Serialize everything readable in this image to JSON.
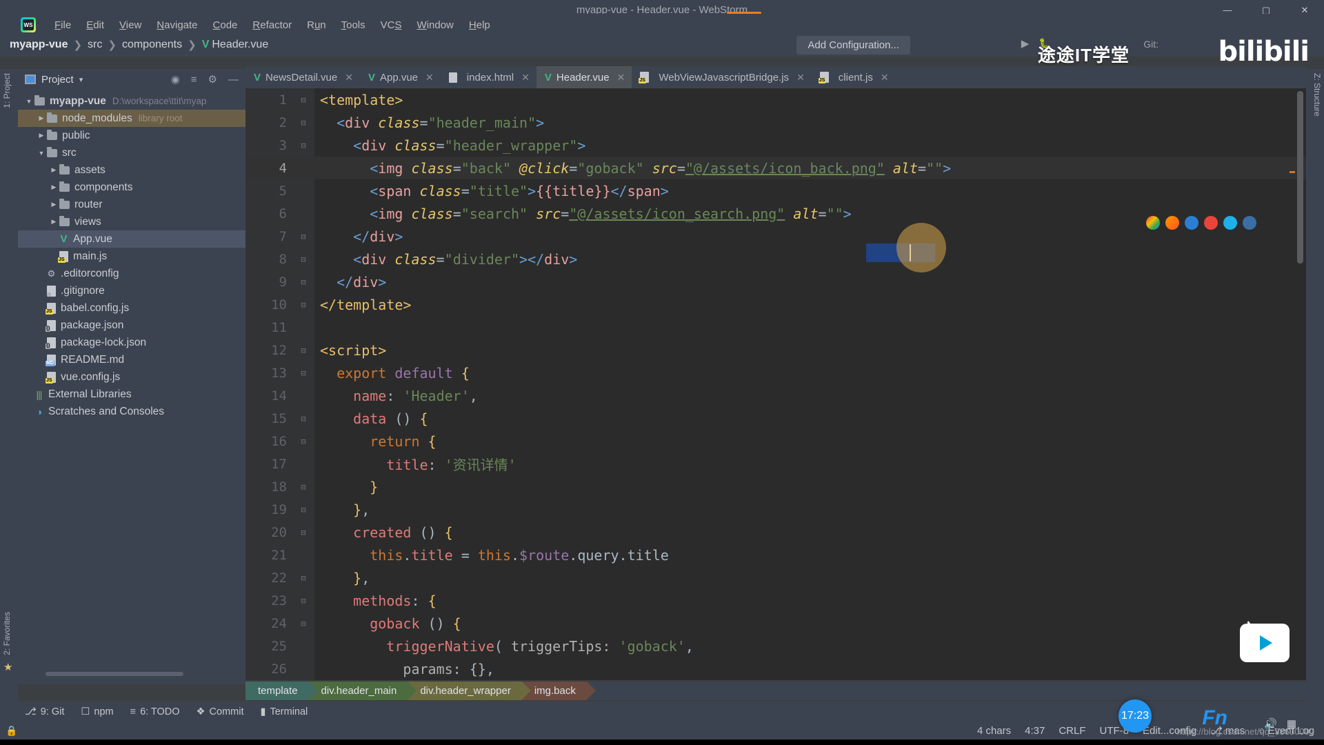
{
  "window": {
    "title": "myapp-vue - Header.vue - WebStorm",
    "minimize": "—",
    "maximize": "▢",
    "close": "✕"
  },
  "menu": {
    "logo": "webstorm-logo",
    "items": [
      {
        "label": "File",
        "mnemonic": "F"
      },
      {
        "label": "Edit",
        "mnemonic": "E"
      },
      {
        "label": "View",
        "mnemonic": "V"
      },
      {
        "label": "Navigate",
        "mnemonic": "N"
      },
      {
        "label": "Code",
        "mnemonic": "C"
      },
      {
        "label": "Refactor",
        "mnemonic": "R"
      },
      {
        "label": "Run",
        "mnemonic": "R"
      },
      {
        "label": "Tools",
        "mnemonic": "T"
      },
      {
        "label": "VCS",
        "mnemonic": "S"
      },
      {
        "label": "Window",
        "mnemonic": "W"
      },
      {
        "label": "Help",
        "mnemonic": "H"
      }
    ]
  },
  "navbar": {
    "breadcrumbs": [
      "myapp-vue",
      "src",
      "components",
      "Header.vue"
    ],
    "separator": "❯",
    "add_configuration": "Add Configuration...",
    "git_label": "Git:"
  },
  "watermark": {
    "tutu": "途途IT学堂",
    "bilibili": "bilibili",
    "csdn": "https://blog.csdn.net/qq_33600000"
  },
  "rails": {
    "left_top": "1: Project",
    "left_bottom": "2: Favorites",
    "right_top": "Z: Structure"
  },
  "project_panel": {
    "title": "Project",
    "caret": "▾",
    "tools": [
      "⊕",
      "⇅",
      "⚙",
      "—"
    ],
    "tree": [
      {
        "label": "myapp-vue",
        "suffix": "D:\\workspace\\ttit\\myap",
        "type": "folder",
        "indent": 0,
        "arrow": "▼",
        "bold": true
      },
      {
        "label": "node_modules",
        "suffix": "library root",
        "type": "folder",
        "indent": 1,
        "arrow": "▶",
        "highlight": true
      },
      {
        "label": "public",
        "type": "folder",
        "indent": 1,
        "arrow": "▶"
      },
      {
        "label": "src",
        "type": "folder",
        "indent": 1,
        "arrow": "▼"
      },
      {
        "label": "assets",
        "type": "folder",
        "indent": 2,
        "arrow": "▶"
      },
      {
        "label": "components",
        "type": "folder",
        "indent": 2,
        "arrow": "▶"
      },
      {
        "label": "router",
        "type": "folder",
        "indent": 2,
        "arrow": "▶"
      },
      {
        "label": "views",
        "type": "folder",
        "indent": 2,
        "arrow": "▶"
      },
      {
        "label": "App.vue",
        "type": "vue",
        "indent": 2,
        "selected": true
      },
      {
        "label": "main.js",
        "type": "js",
        "indent": 2
      },
      {
        "label": ".editorconfig",
        "type": "gear",
        "indent": 1
      },
      {
        "label": ".gitignore",
        "type": "git",
        "indent": 1
      },
      {
        "label": "babel.config.js",
        "type": "js",
        "indent": 1
      },
      {
        "label": "package.json",
        "type": "json",
        "indent": 1
      },
      {
        "label": "package-lock.json",
        "type": "json",
        "indent": 1
      },
      {
        "label": "README.md",
        "type": "md",
        "indent": 1
      },
      {
        "label": "vue.config.js",
        "type": "js",
        "indent": 1
      },
      {
        "label": "External Libraries",
        "type": "lib",
        "indent": 0
      },
      {
        "label": "Scratches and Consoles",
        "type": "scratch",
        "indent": 0
      }
    ]
  },
  "tabs": [
    {
      "label": "NewsDetail.vue",
      "icon": "vue",
      "active": false
    },
    {
      "label": "App.vue",
      "icon": "vue",
      "active": false
    },
    {
      "label": "index.html",
      "icon": "html",
      "active": false
    },
    {
      "label": "Header.vue",
      "icon": "vue",
      "active": true
    },
    {
      "label": "WebViewJavascriptBridge.js",
      "icon": "js",
      "active": false
    },
    {
      "label": "client.js",
      "icon": "js",
      "active": false
    }
  ],
  "editor": {
    "file": "Header.vue",
    "cursor_line": 4,
    "lines": [
      {
        "n": 1,
        "fold": "⊟",
        "tokens": [
          {
            "t": "<",
            "c": "tag"
          },
          {
            "t": "template",
            "c": "tag"
          },
          {
            "t": ">",
            "c": "tag"
          }
        ]
      },
      {
        "n": 2,
        "fold": "⊟",
        "tokens": [
          {
            "t": "  <",
            "c": "punc"
          },
          {
            "t": "div",
            "c": "tagn"
          },
          {
            "t": " ",
            "c": "plain"
          },
          {
            "t": "class",
            "c": "attr"
          },
          {
            "t": "=",
            "c": "plain"
          },
          {
            "t": "\"header_main\"",
            "c": "str"
          },
          {
            "t": ">",
            "c": "punc"
          }
        ]
      },
      {
        "n": 3,
        "fold": "⊟",
        "tokens": [
          {
            "t": "    <",
            "c": "punc"
          },
          {
            "t": "div",
            "c": "tagn"
          },
          {
            "t": " ",
            "c": "plain"
          },
          {
            "t": "class",
            "c": "attr"
          },
          {
            "t": "=",
            "c": "plain"
          },
          {
            "t": "\"header_wrapper\"",
            "c": "str"
          },
          {
            "t": ">",
            "c": "punc"
          }
        ]
      },
      {
        "n": 4,
        "fold": "",
        "cursor": true,
        "tokens": [
          {
            "t": "      <",
            "c": "punc"
          },
          {
            "t": "img",
            "c": "tagn"
          },
          {
            "t": " ",
            "c": "plain"
          },
          {
            "t": "class",
            "c": "attr"
          },
          {
            "t": "=",
            "c": "plain"
          },
          {
            "t": "\"back\"",
            "c": "str"
          },
          {
            "t": " ",
            "c": "plain"
          },
          {
            "t": "@click",
            "c": "attr"
          },
          {
            "t": "=",
            "c": "plain"
          },
          {
            "t": "\"goback\"",
            "c": "str"
          },
          {
            "t": " ",
            "c": "plain"
          },
          {
            "t": "src",
            "c": "attr"
          },
          {
            "t": "=",
            "c": "plain"
          },
          {
            "t": "\"@/assets/icon_back.png\"",
            "c": "strl"
          },
          {
            "t": " ",
            "c": "plain"
          },
          {
            "t": "alt",
            "c": "attr"
          },
          {
            "t": "=",
            "c": "plain"
          },
          {
            "t": "\"\"",
            "c": "str"
          },
          {
            "t": ">",
            "c": "punc"
          }
        ]
      },
      {
        "n": 5,
        "fold": "",
        "tokens": [
          {
            "t": "      <",
            "c": "punc"
          },
          {
            "t": "span",
            "c": "tagn"
          },
          {
            "t": " ",
            "c": "plain"
          },
          {
            "t": "class",
            "c": "attr"
          },
          {
            "t": "=",
            "c": "plain"
          },
          {
            "t": "\"title\"",
            "c": "str"
          },
          {
            "t": ">",
            "c": "punc"
          },
          {
            "t": "{{title}}",
            "c": "mustache"
          },
          {
            "t": "</",
            "c": "punc"
          },
          {
            "t": "span",
            "c": "tagn"
          },
          {
            "t": ">",
            "c": "punc"
          }
        ]
      },
      {
        "n": 6,
        "fold": "",
        "tokens": [
          {
            "t": "      <",
            "c": "punc"
          },
          {
            "t": "img",
            "c": "tagn"
          },
          {
            "t": " ",
            "c": "plain"
          },
          {
            "t": "class",
            "c": "attr"
          },
          {
            "t": "=",
            "c": "plain"
          },
          {
            "t": "\"search\"",
            "c": "str"
          },
          {
            "t": " ",
            "c": "plain"
          },
          {
            "t": "src",
            "c": "attr"
          },
          {
            "t": "=",
            "c": "plain"
          },
          {
            "t": "\"@/assets/icon_search.png\"",
            "c": "strl"
          },
          {
            "t": " ",
            "c": "plain"
          },
          {
            "t": "alt",
            "c": "attr"
          },
          {
            "t": "=",
            "c": "plain"
          },
          {
            "t": "\"\"",
            "c": "str"
          },
          {
            "t": ">",
            "c": "punc"
          }
        ]
      },
      {
        "n": 7,
        "fold": "⊟",
        "tokens": [
          {
            "t": "    </",
            "c": "punc"
          },
          {
            "t": "div",
            "c": "tagn"
          },
          {
            "t": ">",
            "c": "punc"
          }
        ]
      },
      {
        "n": 8,
        "fold": "⊟",
        "tokens": [
          {
            "t": "    <",
            "c": "punc"
          },
          {
            "t": "div",
            "c": "tagn"
          },
          {
            "t": " ",
            "c": "plain"
          },
          {
            "t": "class",
            "c": "attr"
          },
          {
            "t": "=",
            "c": "plain"
          },
          {
            "t": "\"divider\"",
            "c": "str"
          },
          {
            "t": "></",
            "c": "punc"
          },
          {
            "t": "div",
            "c": "tagn"
          },
          {
            "t": ">",
            "c": "punc"
          }
        ]
      },
      {
        "n": 9,
        "fold": "⊟",
        "tokens": [
          {
            "t": "  </",
            "c": "punc"
          },
          {
            "t": "div",
            "c": "tagn"
          },
          {
            "t": ">",
            "c": "punc"
          }
        ]
      },
      {
        "n": 10,
        "fold": "⊟",
        "tokens": [
          {
            "t": "</",
            "c": "tag"
          },
          {
            "t": "template",
            "c": "tag"
          },
          {
            "t": ">",
            "c": "tag"
          }
        ]
      },
      {
        "n": 11,
        "fold": "",
        "tokens": []
      },
      {
        "n": 12,
        "fold": "⊟",
        "tokens": [
          {
            "t": "<",
            "c": "tag"
          },
          {
            "t": "script",
            "c": "tag"
          },
          {
            "t": ">",
            "c": "tag"
          }
        ]
      },
      {
        "n": 13,
        "fold": "⊟",
        "tokens": [
          {
            "t": "  ",
            "c": "plain"
          },
          {
            "t": "export",
            "c": "kw"
          },
          {
            "t": " ",
            "c": "plain"
          },
          {
            "t": "default",
            "c": "kw2"
          },
          {
            "t": " ",
            "c": "plain"
          },
          {
            "t": "{",
            "c": "tag"
          }
        ]
      },
      {
        "n": 14,
        "fold": "",
        "tokens": [
          {
            "t": "    ",
            "c": "plain"
          },
          {
            "t": "name",
            "c": "prop"
          },
          {
            "t": ": ",
            "c": "plain"
          },
          {
            "t": "'Header'",
            "c": "str"
          },
          {
            "t": ",",
            "c": "plain"
          }
        ]
      },
      {
        "n": 15,
        "fold": "⊟",
        "tokens": [
          {
            "t": "    ",
            "c": "plain"
          },
          {
            "t": "data",
            "c": "prop"
          },
          {
            "t": " () ",
            "c": "plain"
          },
          {
            "t": "{",
            "c": "tag"
          }
        ]
      },
      {
        "n": 16,
        "fold": "⊟",
        "tokens": [
          {
            "t": "      ",
            "c": "plain"
          },
          {
            "t": "return",
            "c": "kw"
          },
          {
            "t": " ",
            "c": "plain"
          },
          {
            "t": "{",
            "c": "tag"
          }
        ]
      },
      {
        "n": 17,
        "fold": "",
        "tokens": [
          {
            "t": "        ",
            "c": "plain"
          },
          {
            "t": "title",
            "c": "prop"
          },
          {
            "t": ": ",
            "c": "plain"
          },
          {
            "t": "'资讯详情'",
            "c": "str"
          }
        ]
      },
      {
        "n": 18,
        "fold": "⊟",
        "tokens": [
          {
            "t": "      ",
            "c": "plain"
          },
          {
            "t": "}",
            "c": "tag"
          }
        ]
      },
      {
        "n": 19,
        "fold": "⊟",
        "tokens": [
          {
            "t": "    ",
            "c": "plain"
          },
          {
            "t": "}",
            "c": "tag"
          },
          {
            "t": ",",
            "c": "plain"
          }
        ]
      },
      {
        "n": 20,
        "fold": "⊟",
        "tokens": [
          {
            "t": "    ",
            "c": "plain"
          },
          {
            "t": "created",
            "c": "prop"
          },
          {
            "t": " () ",
            "c": "plain"
          },
          {
            "t": "{",
            "c": "tag"
          }
        ]
      },
      {
        "n": 21,
        "fold": "",
        "tokens": [
          {
            "t": "      ",
            "c": "plain"
          },
          {
            "t": "this",
            "c": "kw"
          },
          {
            "t": ".",
            "c": "plain"
          },
          {
            "t": "title",
            "c": "prop"
          },
          {
            "t": " = ",
            "c": "plain"
          },
          {
            "t": "this",
            "c": "kw"
          },
          {
            "t": ".",
            "c": "plain"
          },
          {
            "t": "$route",
            "c": "kw2"
          },
          {
            "t": ".",
            "c": "plain"
          },
          {
            "t": "query",
            "c": "plain"
          },
          {
            "t": ".",
            "c": "plain"
          },
          {
            "t": "title",
            "c": "plain"
          }
        ]
      },
      {
        "n": 22,
        "fold": "⊟",
        "tokens": [
          {
            "t": "    ",
            "c": "plain"
          },
          {
            "t": "}",
            "c": "tag"
          },
          {
            "t": ",",
            "c": "plain"
          }
        ]
      },
      {
        "n": 23,
        "fold": "⊟",
        "tokens": [
          {
            "t": "    ",
            "c": "plain"
          },
          {
            "t": "methods",
            "c": "prop"
          },
          {
            "t": ": ",
            "c": "plain"
          },
          {
            "t": "{",
            "c": "tag"
          }
        ]
      },
      {
        "n": 24,
        "fold": "⊟",
        "tokens": [
          {
            "t": "      ",
            "c": "plain"
          },
          {
            "t": "goback",
            "c": "prop"
          },
          {
            "t": " () ",
            "c": "plain"
          },
          {
            "t": "{",
            "c": "tag"
          }
        ]
      },
      {
        "n": 25,
        "fold": "",
        "tokens": [
          {
            "t": "        ",
            "c": "plain"
          },
          {
            "t": "triggerNative",
            "c": "prop"
          },
          {
            "t": "( ",
            "c": "plain"
          },
          {
            "t": "triggerTips",
            "c": "param"
          },
          {
            "t": ": ",
            "c": "plain"
          },
          {
            "t": "'goback'",
            "c": "str"
          },
          {
            "t": ",",
            "c": "plain"
          }
        ]
      },
      {
        "n": 26,
        "fold": "",
        "tokens": [
          {
            "t": "          ",
            "c": "plain"
          },
          {
            "t": "params",
            "c": "param"
          },
          {
            "t": ": ",
            "c": "plain"
          },
          {
            "t": "{}",
            "c": "plain"
          },
          {
            "t": ",",
            "c": "plain"
          }
        ]
      }
    ]
  },
  "element_path": [
    {
      "label": "template",
      "color": "#3f6b62"
    },
    {
      "label": "div.header_main",
      "color": "#4c6b3f"
    },
    {
      "label": "div.header_wrapper",
      "color": "#6b6a3f"
    },
    {
      "label": "img.back",
      "color": "#6b4a3f"
    }
  ],
  "bottom_toolbar": [
    {
      "label": "9: Git",
      "mnemonic": "9",
      "icon": "branch-icon"
    },
    {
      "label": "npm",
      "icon": "npm-icon"
    },
    {
      "label": "6: TODO",
      "mnemonic": "6",
      "icon": "todo-icon"
    },
    {
      "label": "Commit",
      "icon": "commit-icon"
    },
    {
      "label": "Terminal",
      "icon": "terminal-icon"
    }
  ],
  "statusbar": {
    "chars": "4 chars",
    "position": "4:37",
    "line_ending": "CRLF",
    "encoding": "UTF-8",
    "indent": "Edit...config",
    "branch": "mas",
    "event_log": "Event Log",
    "lock": "lock-icon"
  },
  "tray": {
    "clock": "17:23",
    "fn": "Fn"
  }
}
